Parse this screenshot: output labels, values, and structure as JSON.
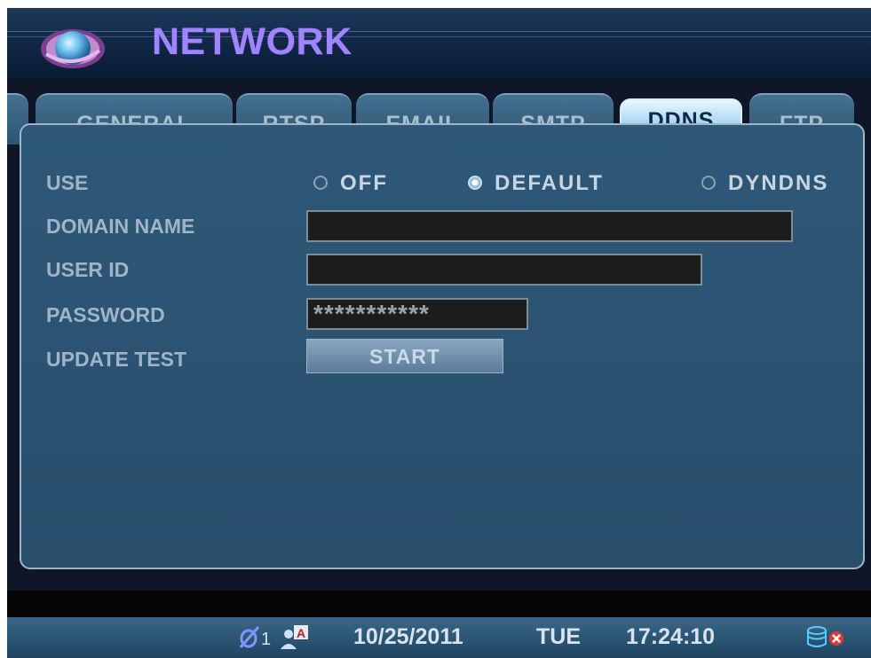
{
  "header": {
    "title": "NETWORK"
  },
  "tabs": [
    {
      "label": "GENERAL",
      "active": false
    },
    {
      "label": "RTSP",
      "active": false
    },
    {
      "label": "EMAIL",
      "active": false
    },
    {
      "label": "SMTP",
      "active": false
    },
    {
      "label": "DDNS",
      "active": true
    },
    {
      "label": "FTP",
      "active": false
    }
  ],
  "form": {
    "use": {
      "label": "USE",
      "options": [
        "OFF",
        "DEFAULT",
        "DYNDNS"
      ],
      "selected": "DEFAULT"
    },
    "domain_name": {
      "label": "DOMAIN NAME",
      "value": ""
    },
    "user_id": {
      "label": "USER ID",
      "value": ""
    },
    "password": {
      "label": "PASSWORD",
      "value": "***********"
    },
    "update_test": {
      "label": "UPDATE TEST",
      "button": "START"
    }
  },
  "status": {
    "channel_count": "1",
    "user_badge": "A",
    "date": "10/25/2011",
    "day": "TUE",
    "time": "17:24:10",
    "icons": [
      "no-camera-icon",
      "user-admin-icon",
      "disk-icon",
      "error-x-icon"
    ]
  },
  "colors": {
    "title": "#9f86ff",
    "panel": "#2f5878",
    "active_tab": "#a9d6f3",
    "background": "#0f1628"
  }
}
